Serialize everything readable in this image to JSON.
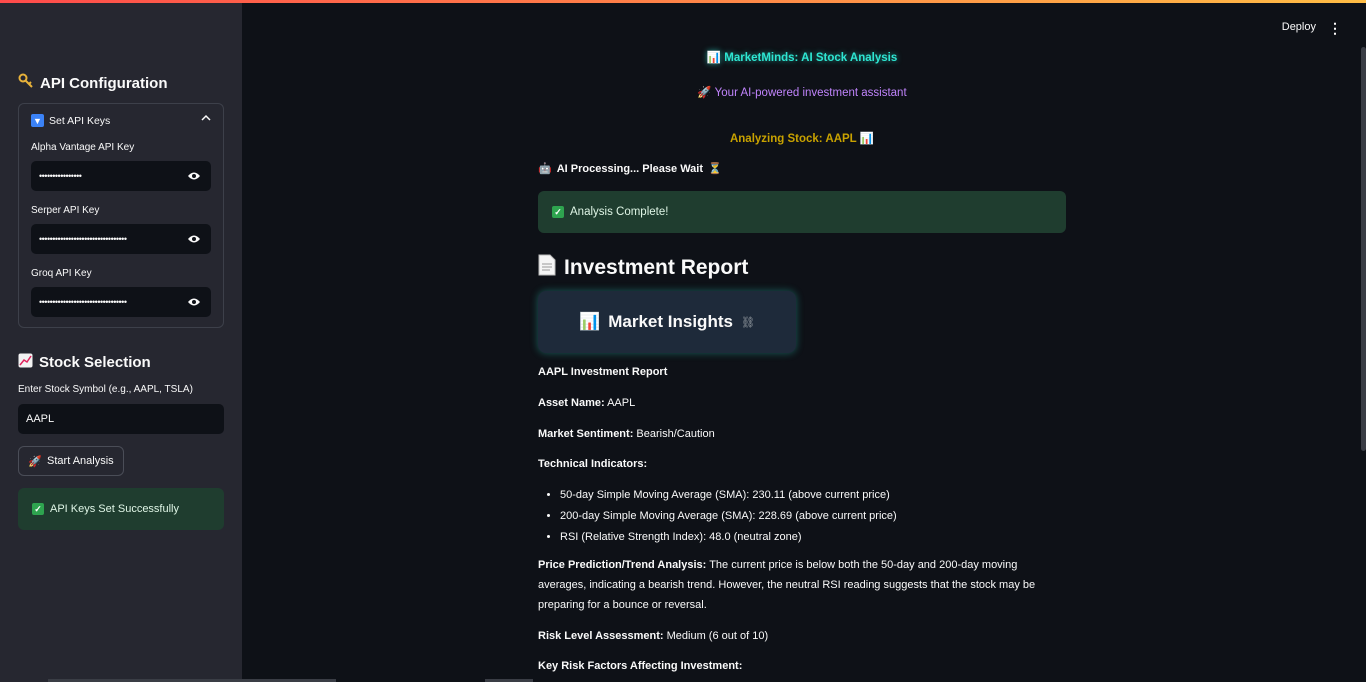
{
  "sidebar": {
    "api_heading": "API Configuration",
    "expander_label": "Set API Keys",
    "alpha_label": "Alpha Vantage API Key",
    "alpha_value": "••••••••••••••••",
    "serper_label": "Serper API Key",
    "serper_value": "•••••••••••••••••••••••••••••••••",
    "groq_label": "Groq API Key",
    "groq_value": "•••••••••••••••••••••••••••••••••",
    "stock_heading": "Stock Selection",
    "symbol_label": "Enter Stock Symbol (e.g., AAPL, TSLA)",
    "symbol_value": "AAPL",
    "start_button": "Start Analysis",
    "success_text": "API Keys Set Successfully"
  },
  "header": {
    "deploy": "Deploy"
  },
  "main": {
    "title": "MarketMinds: AI Stock Analysis",
    "subtitle": "Your AI-powered investment assistant",
    "analyzing": "Analyzing Stock: AAPL",
    "processing": "AI Processing... Please Wait",
    "complete": "Analysis Complete!",
    "report_heading": "Investment Report",
    "insights_title": "Market Insights",
    "report_title": "AAPL Investment Report",
    "asset_label": "Asset Name:",
    "asset_value": "AAPL",
    "sentiment_label": "Market Sentiment:",
    "sentiment_value": "Bearish/Caution",
    "technical_label": "Technical Indicators:",
    "indicators": [
      "50-day Simple Moving Average (SMA): 230.11 (above current price)",
      "200-day Simple Moving Average (SMA): 228.69 (above current price)",
      "RSI (Relative Strength Index): 48.0 (neutral zone)"
    ],
    "trend_label": "Price Prediction/Trend Analysis:",
    "trend_value": "The current price is below both the 50-day and 200-day moving averages, indicating a bearish trend. However, the neutral RSI reading suggests that the stock may be preparing for a bounce or reversal.",
    "risk_label": "Risk Level Assessment:",
    "risk_value": "Medium (6 out of 10)",
    "key_risk_label": "Key Risk Factors Affecting Investment:"
  }
}
